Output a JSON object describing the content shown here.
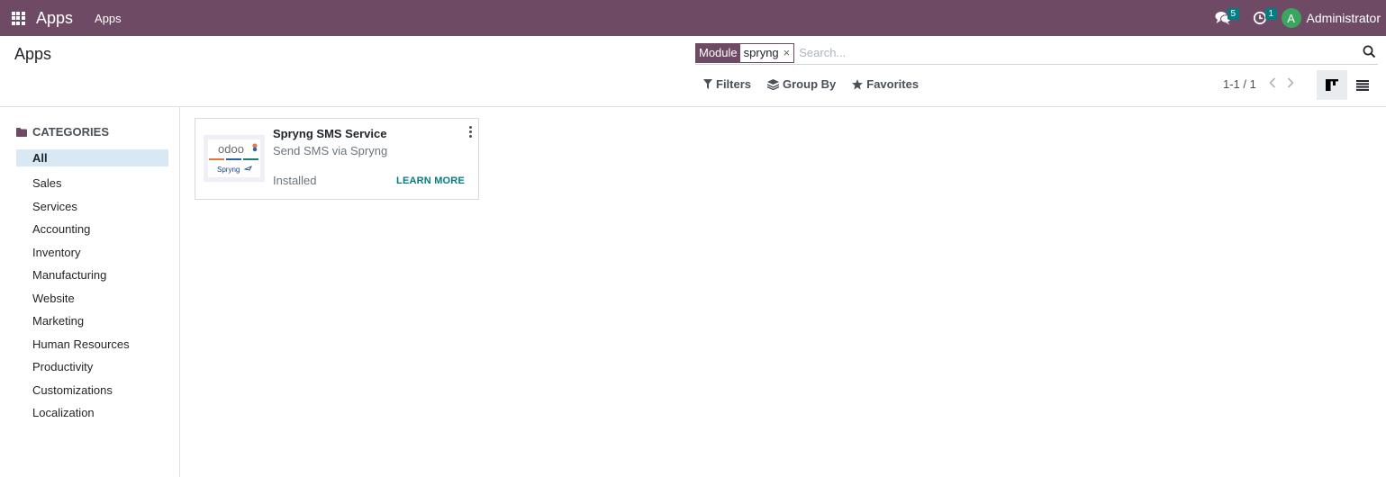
{
  "navbar": {
    "brand": "Apps",
    "menu_item": "Apps",
    "messages_count": "5",
    "activities_count": "1",
    "user_initial": "A",
    "user_name": "Administrator",
    "background_color": "#6f4a64"
  },
  "control_panel": {
    "title": "Apps",
    "search": {
      "facet_label": "Module",
      "facet_value": "spryng",
      "placeholder": "Search..."
    },
    "filters_label": "Filters",
    "group_by_label": "Group By",
    "favorites_label": "Favorites",
    "pager": "1-1 / 1"
  },
  "sidebar": {
    "header": "CATEGORIES",
    "items": [
      {
        "label": "All",
        "active": true
      },
      {
        "label": "Sales"
      },
      {
        "label": "Services"
      },
      {
        "label": "Accounting"
      },
      {
        "label": "Inventory"
      },
      {
        "label": "Manufacturing"
      },
      {
        "label": "Website"
      },
      {
        "label": "Marketing"
      },
      {
        "label": "Human Resources"
      },
      {
        "label": "Productivity"
      },
      {
        "label": "Customizations"
      },
      {
        "label": "Localization"
      }
    ]
  },
  "card": {
    "title": "Spryng SMS Service",
    "subtitle": "Send SMS via Spryng",
    "status": "Installed",
    "learn_more": "LEARN MORE",
    "logo_text": "odoo",
    "logo_sub": "Spryng"
  }
}
